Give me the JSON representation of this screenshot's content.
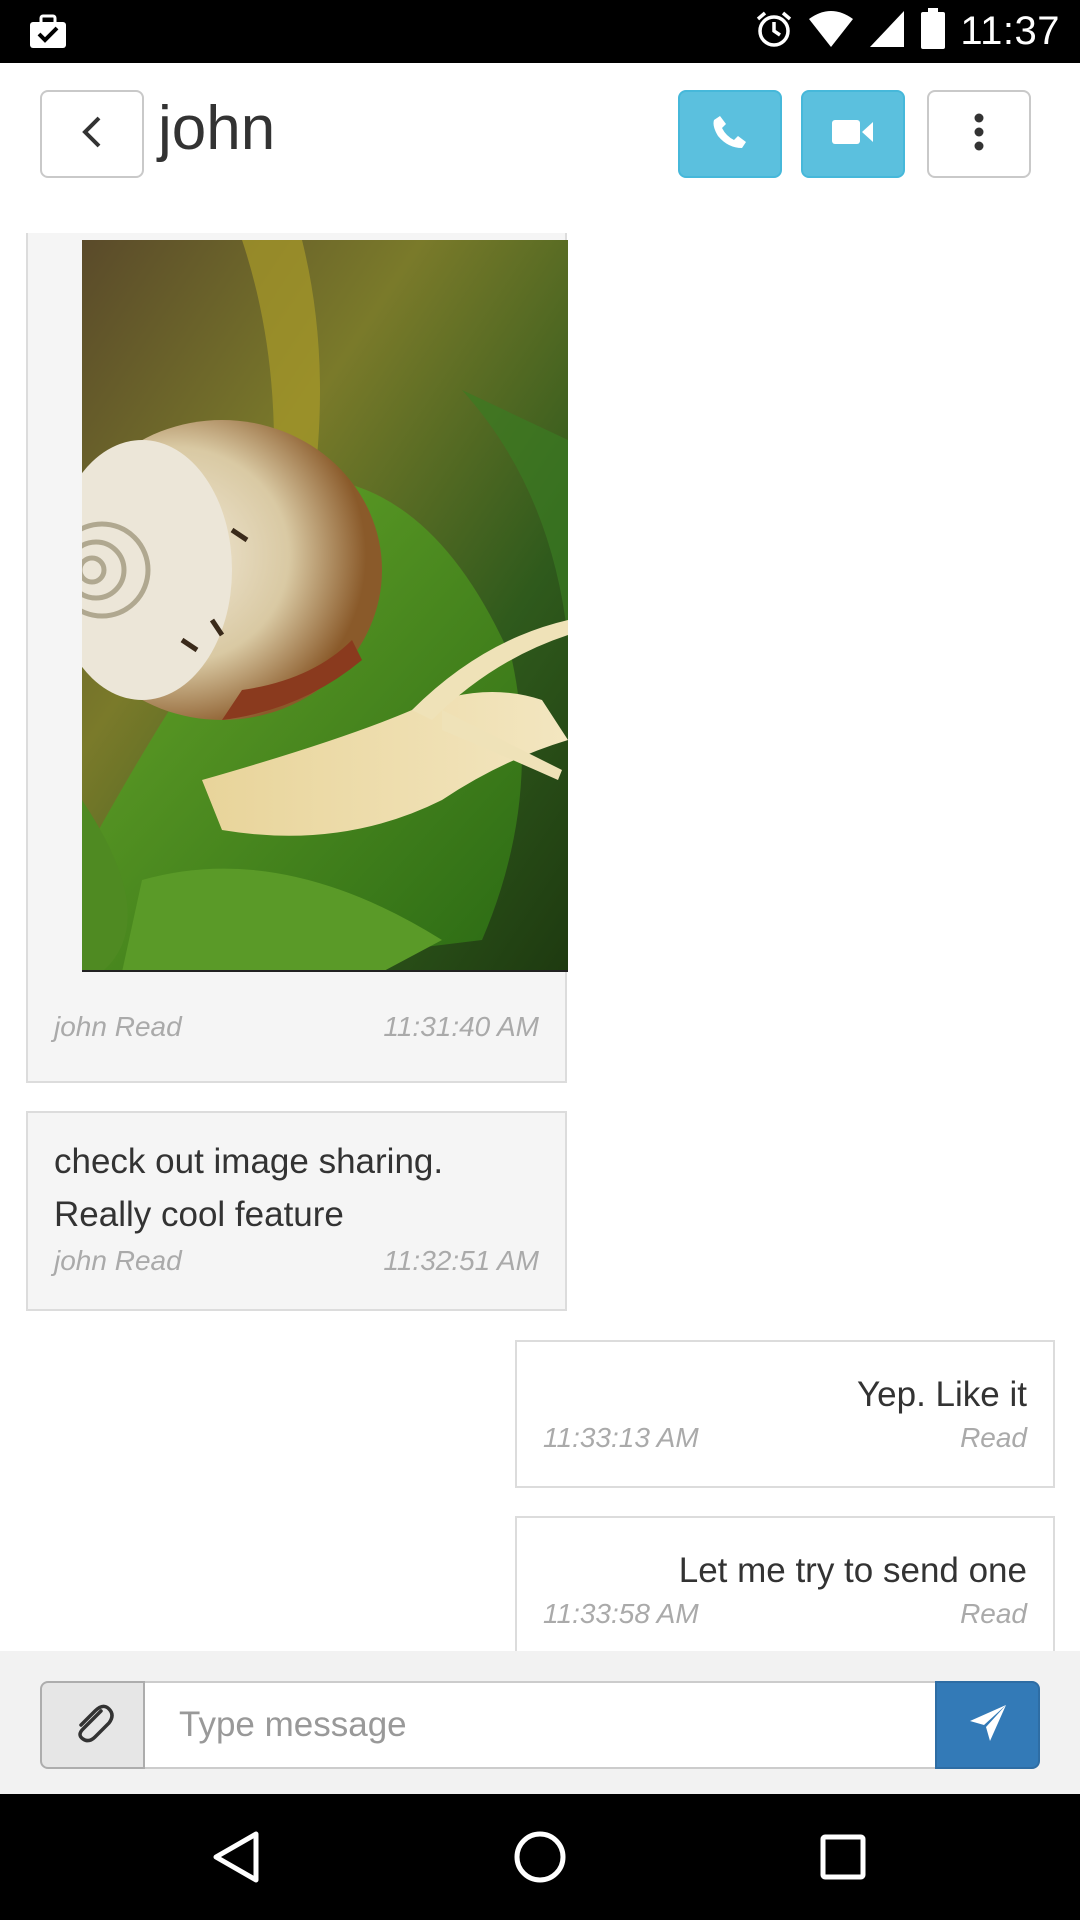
{
  "status_bar": {
    "time": "11:37",
    "icons": [
      "briefcase-check-icon",
      "alarm-icon",
      "wifi-icon",
      "signal-icon",
      "battery-icon"
    ]
  },
  "header": {
    "title": "john",
    "back_icon": "chevron-left-icon",
    "call_icon": "phone-icon",
    "video_icon": "video-camera-icon",
    "more_icon": "more-vertical-icon",
    "accent_color": "#5bc0de"
  },
  "messages": [
    {
      "direction": "in",
      "type": "image",
      "image_subject": "snail on green leaf",
      "sender_status": "john Read",
      "time": "11:31:40 AM"
    },
    {
      "direction": "in",
      "type": "text",
      "lines": [
        "check out image sharing.",
        "Really cool feature"
      ],
      "sender_status": "john Read",
      "time": "11:32:51 AM"
    },
    {
      "direction": "out",
      "type": "text",
      "text": "Yep. Like it",
      "time": "11:33:13 AM",
      "status": "Read"
    },
    {
      "direction": "out",
      "type": "text",
      "text": "Let me try to send one",
      "time": "11:33:58 AM",
      "status": "Read"
    }
  ],
  "composer": {
    "placeholder": "Type message",
    "value": "",
    "attach_icon": "paperclip-icon",
    "send_icon": "send-icon",
    "send_color": "#337ab7"
  },
  "nav_bar": {
    "icons": [
      "back-triangle-icon",
      "home-circle-icon",
      "recents-square-icon"
    ]
  }
}
